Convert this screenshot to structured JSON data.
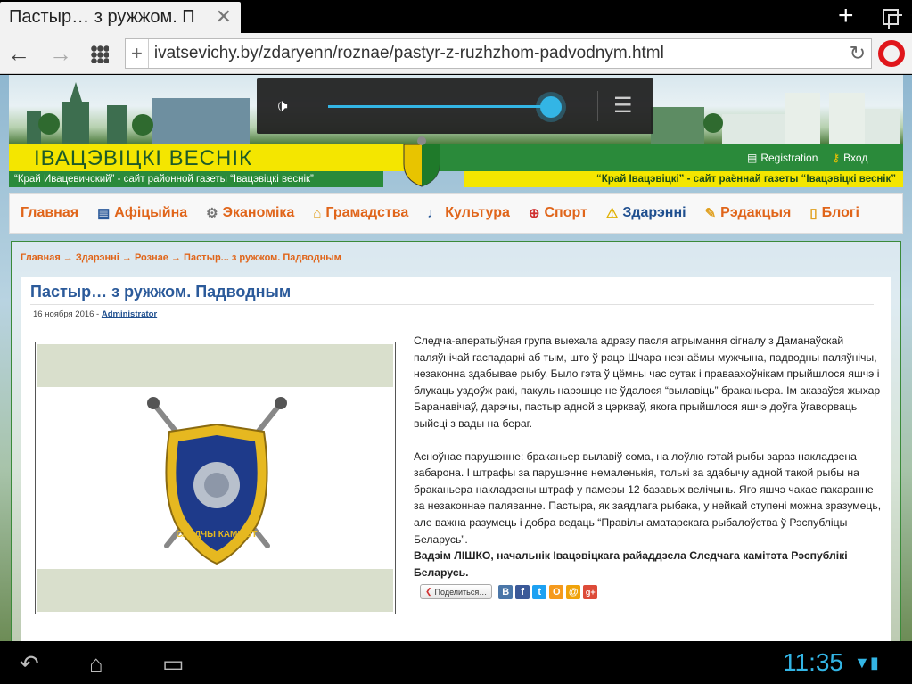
{
  "browser": {
    "tab_title": "Пастыр… з ружжом. П",
    "tab_close": "✕",
    "new_tab": "+",
    "url": "ivatsevichy.by/zdaryenn/roznae/pastyr-z-ruzhzhom-padvodnym.html",
    "icons": [
      "back-icon",
      "forward-icon",
      "speed-dial-icon",
      "add-bookmark-icon",
      "reload-icon",
      "opera-icon",
      "tabs-icon"
    ]
  },
  "volume_overlay": {
    "level_fraction": 0.9
  },
  "header": {
    "title": "ІВАЦЭВІЦКІ ВЕСНІК",
    "tagline_left": "“Край Ивацевичский” - сайт районной газеты “Івацэвіцкі веснік”",
    "tagline_right": "“Край Івацэвіцкі” - сайт раённай газеты “Івацэвіцкі веснік”",
    "registration": "Registration",
    "login": "Вход"
  },
  "menu": [
    {
      "label": "Главная",
      "icon": ""
    },
    {
      "label": "Афіцыйна",
      "icon": "▤"
    },
    {
      "label": "Эканоміка",
      "icon": "⚙"
    },
    {
      "label": "Грамадства",
      "icon": "⌂"
    },
    {
      "label": "Культура",
      "icon": "♩"
    },
    {
      "label": "Спорт",
      "icon": "⊕"
    },
    {
      "label": "Здарэнні",
      "icon": "⚠"
    },
    {
      "label": "Рэдакцыя",
      "icon": "✎"
    },
    {
      "label": "Блогі",
      "icon": "▯"
    }
  ],
  "breadcrumb": "Главная  →  Здарэнні  →  Рознае  →  Пастыр... з ружжом. Падводным",
  "article": {
    "title": "Пастыр… з ружжом. Падводным",
    "date": "16 ноября 2016 - ",
    "author": "Administrator",
    "paragraph1": "Следча-аператыўная група выехала адразу пасля атрымання сігналу з Даманаўскай паляўнічай гаспадаркі аб тым, што ў рацэ Шчара незнаёмы мужчына, падводны паляўнічы, незаконна здабывае рыбу. Было гэта ў цёмны час сутак і праваахоўнікам прыйшлося яшчэ і блукаць уздоўж ракі, пакуль нарэшце не ўдалося “вылавіць” браканьера. Ім аказаўся жыхар Баранавічаў, дарэчы, пастыр адной з цэркваў, якога прыйшлося яшчэ доўга ўгаворваць выйсці з вады на бераг.",
    "paragraph2": "Асноўнае парушэнне: браканьер вылавіў сома, на лоўлю гэтай рыбы зараз накладзена забарона. І штрафы за парушэнне немаленькія, толькі за здабычу адной такой рыбы на браканьера накладзены штраф у памеры 12 базавых велічынь. Яго яшчэ чакае пакаранне за незаконнае паляванне. Пастыра, як заядлага рыбака, у нейкай ступені можна зразумець, але важна разумець і добра ведаць “Правілы аматарскага рыбалоўства ў Рэспубліцы Беларусь”.",
    "signature": "Вадзім ЛІШКО, начальнік Івацэвіцкага райаддзела Следчага камітэта Рэспублікі Беларусь.",
    "emblem_text": "СЛЕДЧЫ КАМІТЭТ",
    "share_label": "Поделиться…",
    "share_services": [
      {
        "name": "vk",
        "glyph": "В",
        "color": "#4a76a8"
      },
      {
        "name": "facebook",
        "glyph": "f",
        "color": "#3b5998"
      },
      {
        "name": "twitter",
        "glyph": "t",
        "color": "#1da1f2"
      },
      {
        "name": "odnoklassniki",
        "glyph": "О",
        "color": "#f59a1d"
      },
      {
        "name": "mail",
        "glyph": "@",
        "color": "#f0a30a"
      },
      {
        "name": "googleplus",
        "glyph": "g+",
        "color": "#dd4b39"
      }
    ]
  },
  "system": {
    "clock": "11:35"
  }
}
